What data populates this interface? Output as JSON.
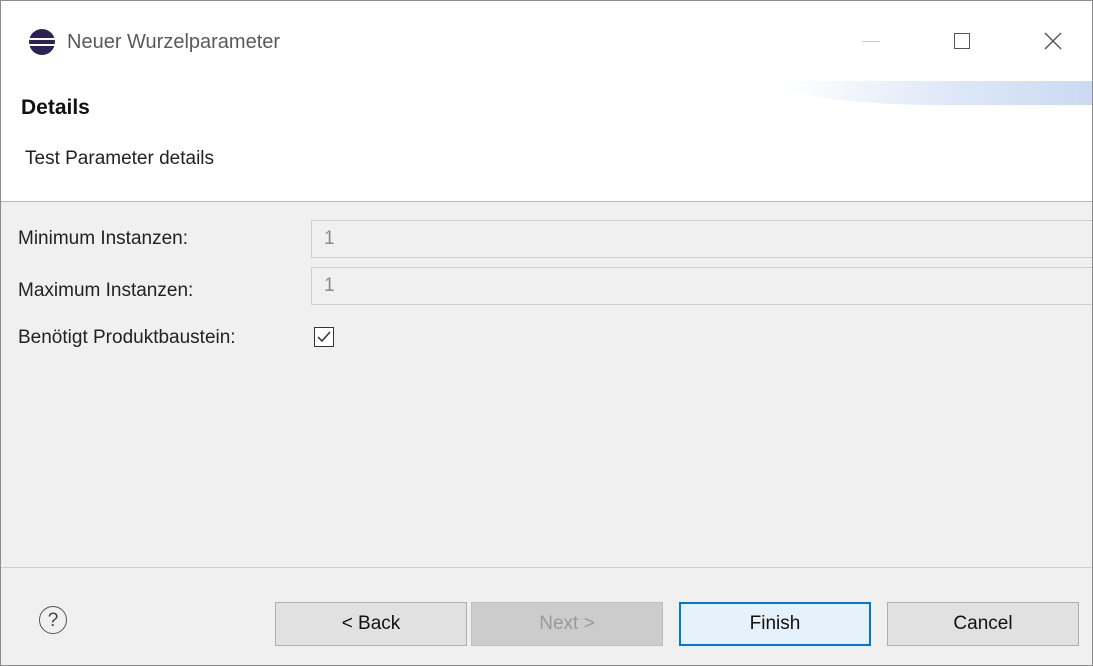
{
  "window": {
    "title": "Neuer Wurzelparameter",
    "icon": "eclipse-icon"
  },
  "header": {
    "title": "Details",
    "description": "Test Parameter details"
  },
  "form": {
    "min_label": "Minimum Instanzen:",
    "min_value": "1",
    "max_label": "Maximum Instanzen:",
    "max_value": "1",
    "required_label": "Benötigt Produktbaustein:",
    "required_checked": true
  },
  "footer": {
    "help_glyph": "?",
    "back_label": "< Back",
    "next_label": "Next >",
    "finish_label": "Finish",
    "cancel_label": "Cancel"
  },
  "colors": {
    "accent": "#0078d7",
    "dialog_bg": "#f0f0f0",
    "header_bg": "#ffffff"
  }
}
